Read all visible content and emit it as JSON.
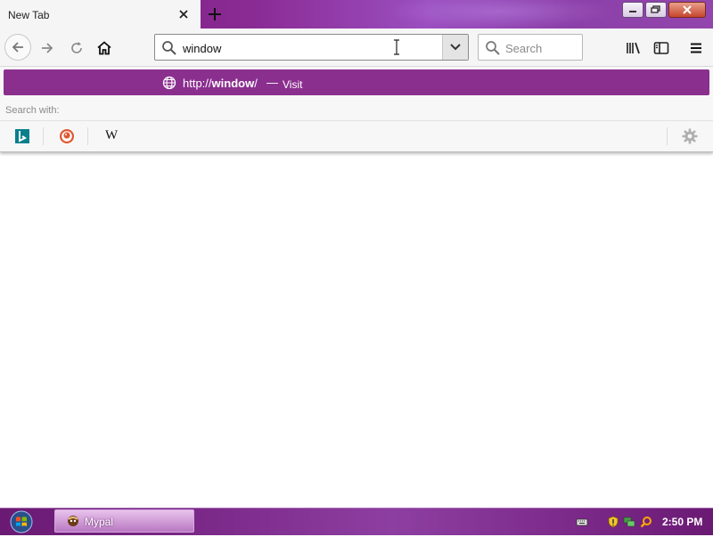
{
  "tab": {
    "title": "New Tab",
    "close_icon": "close-icon"
  },
  "new_tab_icon": "plus-icon",
  "window_controls": [
    "minimize-icon",
    "restore-icon",
    "close-icon"
  ],
  "nav": {
    "back_icon": "arrow-left-icon",
    "forward_icon": "arrow-right-icon",
    "reload_icon": "reload-icon",
    "home_icon": "home-icon"
  },
  "urlbar": {
    "value": "window",
    "dropdown_icon": "chevron-down-icon"
  },
  "searchbar": {
    "placeholder": "Search"
  },
  "toolbar_right": [
    "library-icon",
    "sidebar-icon",
    "menu-icon"
  ],
  "autocomplete": {
    "result": {
      "prefix": "http://",
      "bold": "window",
      "suffix": "/",
      "separator": "—",
      "action": "Visit"
    },
    "search_with_label": "Search with:",
    "engines": [
      "bing-icon",
      "duckduckgo-icon",
      "wikipedia-icon"
    ],
    "wiki_glyph": "W",
    "settings_icon": "gear-icon"
  },
  "taskbar": {
    "app_label": "Mypal",
    "clock": "2:50 PM"
  },
  "colors": {
    "accent": "#8b2f8f",
    "taskbar": "#7c2a8a"
  }
}
